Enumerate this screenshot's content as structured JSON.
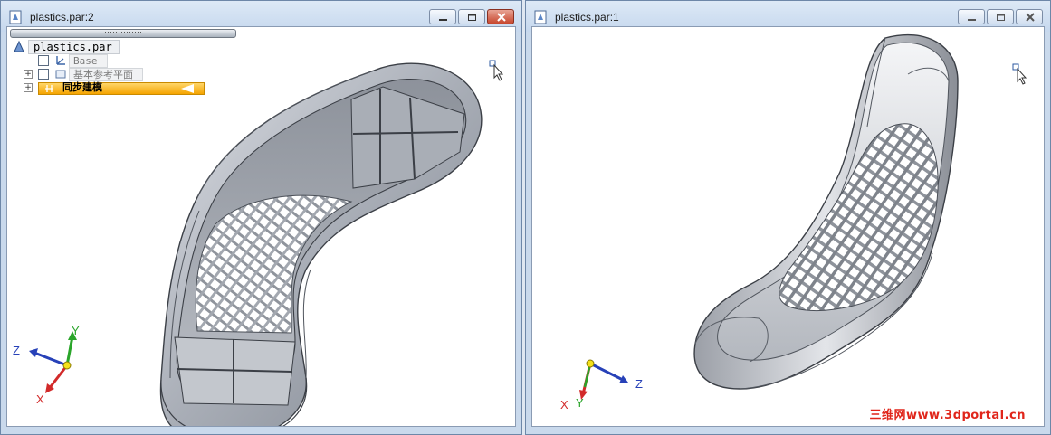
{
  "windows": {
    "left": {
      "title": "plastics.par:2",
      "active": true,
      "tree": {
        "root": "plastics.par",
        "items": [
          {
            "label": "Base"
          },
          {
            "label": "基本参考平面"
          },
          {
            "label": "同步建模"
          }
        ]
      },
      "triad": {
        "x": "X",
        "y": "Y",
        "z": "Z"
      }
    },
    "right": {
      "title": "plastics.par:1",
      "active": false,
      "triad": {
        "x": "X",
        "y": "Y",
        "z": "Z"
      }
    }
  },
  "watermark": "三维网www.3dportal.cn",
  "colors": {
    "accent": "#f5a400",
    "close_active": "#c7462d",
    "model_fill": "#b3b7c0"
  }
}
